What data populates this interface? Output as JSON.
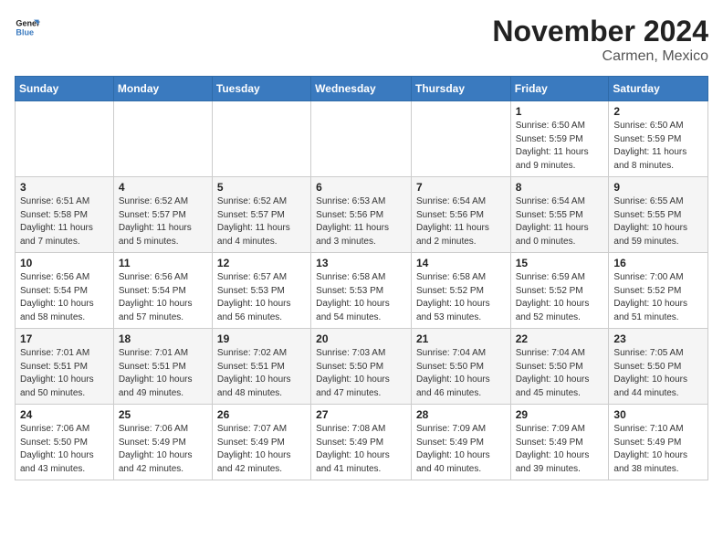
{
  "header": {
    "logo_line1": "General",
    "logo_line2": "Blue",
    "month_year": "November 2024",
    "location": "Carmen, Mexico"
  },
  "days_of_week": [
    "Sunday",
    "Monday",
    "Tuesday",
    "Wednesday",
    "Thursday",
    "Friday",
    "Saturday"
  ],
  "weeks": [
    [
      {
        "day": "",
        "info": ""
      },
      {
        "day": "",
        "info": ""
      },
      {
        "day": "",
        "info": ""
      },
      {
        "day": "",
        "info": ""
      },
      {
        "day": "",
        "info": ""
      },
      {
        "day": "1",
        "info": "Sunrise: 6:50 AM\nSunset: 5:59 PM\nDaylight: 11 hours and 9 minutes."
      },
      {
        "day": "2",
        "info": "Sunrise: 6:50 AM\nSunset: 5:59 PM\nDaylight: 11 hours and 8 minutes."
      }
    ],
    [
      {
        "day": "3",
        "info": "Sunrise: 6:51 AM\nSunset: 5:58 PM\nDaylight: 11 hours and 7 minutes."
      },
      {
        "day": "4",
        "info": "Sunrise: 6:52 AM\nSunset: 5:57 PM\nDaylight: 11 hours and 5 minutes."
      },
      {
        "day": "5",
        "info": "Sunrise: 6:52 AM\nSunset: 5:57 PM\nDaylight: 11 hours and 4 minutes."
      },
      {
        "day": "6",
        "info": "Sunrise: 6:53 AM\nSunset: 5:56 PM\nDaylight: 11 hours and 3 minutes."
      },
      {
        "day": "7",
        "info": "Sunrise: 6:54 AM\nSunset: 5:56 PM\nDaylight: 11 hours and 2 minutes."
      },
      {
        "day": "8",
        "info": "Sunrise: 6:54 AM\nSunset: 5:55 PM\nDaylight: 11 hours and 0 minutes."
      },
      {
        "day": "9",
        "info": "Sunrise: 6:55 AM\nSunset: 5:55 PM\nDaylight: 10 hours and 59 minutes."
      }
    ],
    [
      {
        "day": "10",
        "info": "Sunrise: 6:56 AM\nSunset: 5:54 PM\nDaylight: 10 hours and 58 minutes."
      },
      {
        "day": "11",
        "info": "Sunrise: 6:56 AM\nSunset: 5:54 PM\nDaylight: 10 hours and 57 minutes."
      },
      {
        "day": "12",
        "info": "Sunrise: 6:57 AM\nSunset: 5:53 PM\nDaylight: 10 hours and 56 minutes."
      },
      {
        "day": "13",
        "info": "Sunrise: 6:58 AM\nSunset: 5:53 PM\nDaylight: 10 hours and 54 minutes."
      },
      {
        "day": "14",
        "info": "Sunrise: 6:58 AM\nSunset: 5:52 PM\nDaylight: 10 hours and 53 minutes."
      },
      {
        "day": "15",
        "info": "Sunrise: 6:59 AM\nSunset: 5:52 PM\nDaylight: 10 hours and 52 minutes."
      },
      {
        "day": "16",
        "info": "Sunrise: 7:00 AM\nSunset: 5:52 PM\nDaylight: 10 hours and 51 minutes."
      }
    ],
    [
      {
        "day": "17",
        "info": "Sunrise: 7:01 AM\nSunset: 5:51 PM\nDaylight: 10 hours and 50 minutes."
      },
      {
        "day": "18",
        "info": "Sunrise: 7:01 AM\nSunset: 5:51 PM\nDaylight: 10 hours and 49 minutes."
      },
      {
        "day": "19",
        "info": "Sunrise: 7:02 AM\nSunset: 5:51 PM\nDaylight: 10 hours and 48 minutes."
      },
      {
        "day": "20",
        "info": "Sunrise: 7:03 AM\nSunset: 5:50 PM\nDaylight: 10 hours and 47 minutes."
      },
      {
        "day": "21",
        "info": "Sunrise: 7:04 AM\nSunset: 5:50 PM\nDaylight: 10 hours and 46 minutes."
      },
      {
        "day": "22",
        "info": "Sunrise: 7:04 AM\nSunset: 5:50 PM\nDaylight: 10 hours and 45 minutes."
      },
      {
        "day": "23",
        "info": "Sunrise: 7:05 AM\nSunset: 5:50 PM\nDaylight: 10 hours and 44 minutes."
      }
    ],
    [
      {
        "day": "24",
        "info": "Sunrise: 7:06 AM\nSunset: 5:50 PM\nDaylight: 10 hours and 43 minutes."
      },
      {
        "day": "25",
        "info": "Sunrise: 7:06 AM\nSunset: 5:49 PM\nDaylight: 10 hours and 42 minutes."
      },
      {
        "day": "26",
        "info": "Sunrise: 7:07 AM\nSunset: 5:49 PM\nDaylight: 10 hours and 42 minutes."
      },
      {
        "day": "27",
        "info": "Sunrise: 7:08 AM\nSunset: 5:49 PM\nDaylight: 10 hours and 41 minutes."
      },
      {
        "day": "28",
        "info": "Sunrise: 7:09 AM\nSunset: 5:49 PM\nDaylight: 10 hours and 40 minutes."
      },
      {
        "day": "29",
        "info": "Sunrise: 7:09 AM\nSunset: 5:49 PM\nDaylight: 10 hours and 39 minutes."
      },
      {
        "day": "30",
        "info": "Sunrise: 7:10 AM\nSunset: 5:49 PM\nDaylight: 10 hours and 38 minutes."
      }
    ]
  ]
}
